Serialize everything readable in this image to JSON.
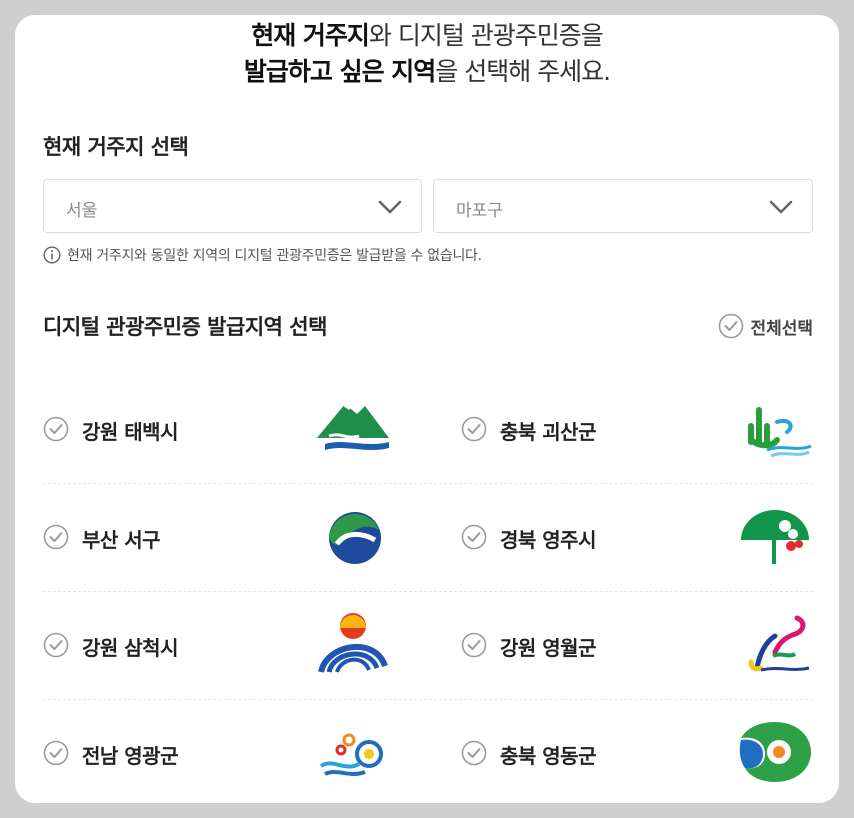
{
  "headline": {
    "line1_bold": "현재 거주지",
    "line1_rest": "와 디지털 관광주민증을",
    "line2_bold": "발급하고 싶은 지역",
    "line2_rest": "을 선택해 주세요."
  },
  "residence": {
    "title": "현재 거주지 선택",
    "city_value": "서울",
    "district_value": "마포구",
    "notice": "현재 거주지와 동일한 지역의 디지털 관광주민증은 발급받을 수 없습니다."
  },
  "issue": {
    "title": "디지털 관광주민증 발급지역 선택",
    "select_all_label": "전체선택"
  },
  "regions": [
    {
      "name": "강원 태백시",
      "logo": "taebaek-logo"
    },
    {
      "name": "충북 괴산군",
      "logo": "goesan-logo"
    },
    {
      "name": "부산 서구",
      "logo": "busan-seogu-logo"
    },
    {
      "name": "경북 영주시",
      "logo": "yeongju-logo"
    },
    {
      "name": "강원 삼척시",
      "logo": "samcheok-logo"
    },
    {
      "name": "강원 영월군",
      "logo": "yeongwol-logo"
    },
    {
      "name": "전남 영광군",
      "logo": "yeonggwang-logo"
    },
    {
      "name": "충북 영동군",
      "logo": "yeongdong-logo"
    }
  ],
  "icons": {
    "check": "check-circle-icon",
    "chevron": "chevron-down-icon",
    "info": "info-circle-icon"
  },
  "colors": {
    "check_gray": "#9a9a9a",
    "select_border": "#dcdcdc",
    "text_dark": "#222222"
  }
}
